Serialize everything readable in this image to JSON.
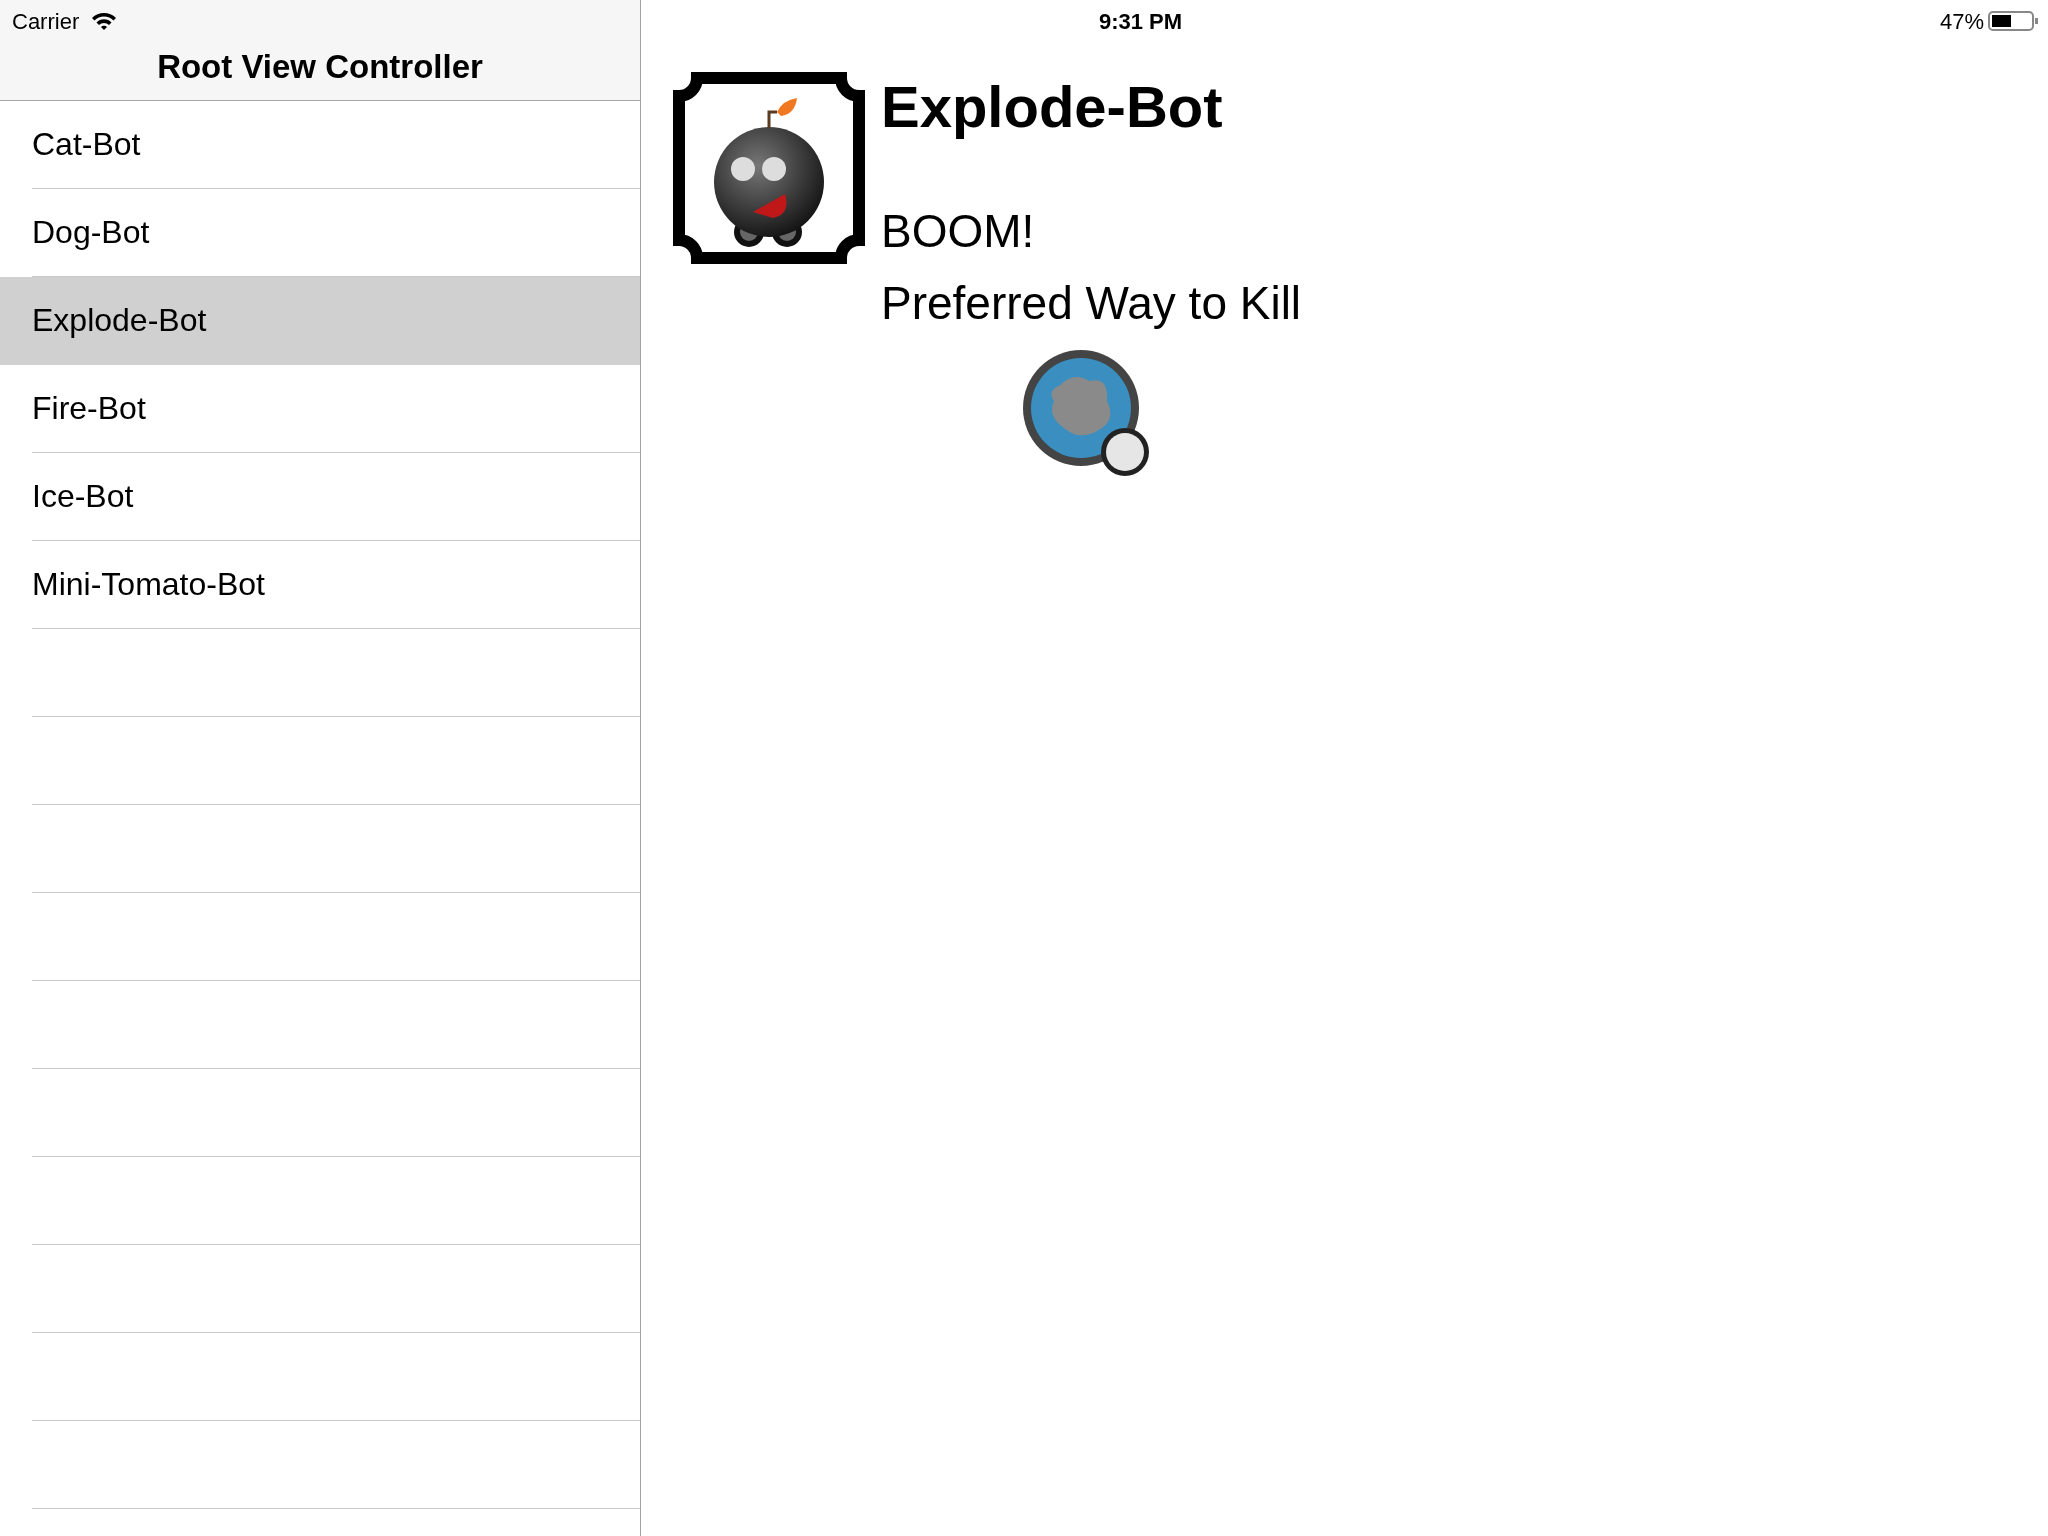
{
  "status_bar": {
    "carrier": "Carrier",
    "time": "9:31 PM",
    "battery": "47%"
  },
  "sidebar": {
    "title": "Root View Controller",
    "items": [
      {
        "label": "Cat-Bot",
        "selected": false
      },
      {
        "label": "Dog-Bot",
        "selected": false
      },
      {
        "label": "Explode-Bot",
        "selected": true
      },
      {
        "label": "Fire-Bot",
        "selected": false
      },
      {
        "label": "Ice-Bot",
        "selected": false
      },
      {
        "label": "Mini-Tomato-Bot",
        "selected": false
      }
    ]
  },
  "detail": {
    "name": "Explode-Bot",
    "catchphrase": "BOOM!",
    "label": "Preferred Way to Kill"
  }
}
